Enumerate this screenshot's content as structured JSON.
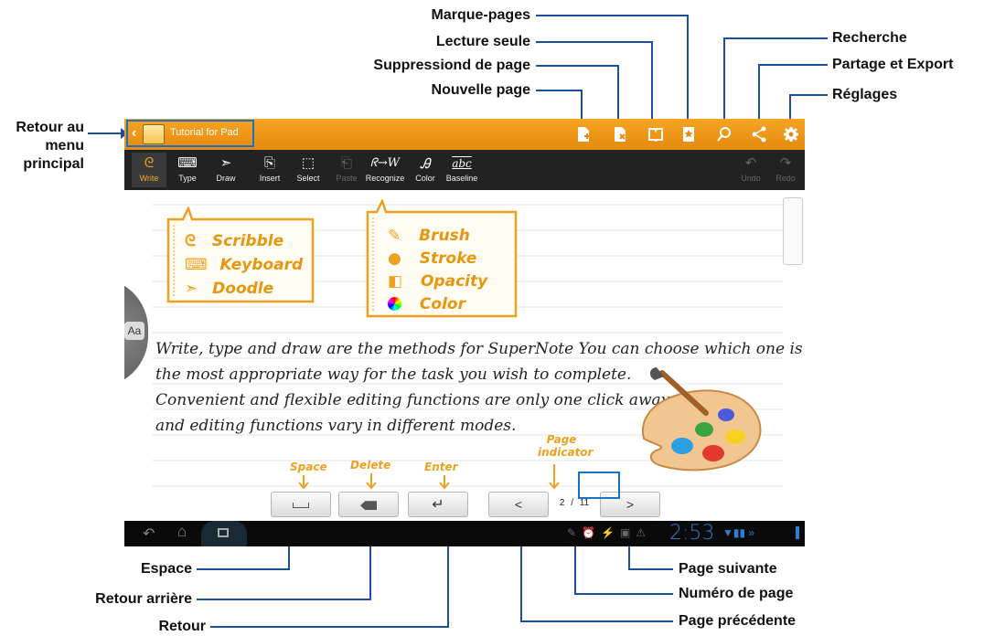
{
  "callouts": {
    "back_to_menu": "Retour au menu principal",
    "marque_pages": "Marque-pages",
    "lecture_seule": "Lecture seule",
    "suppression": "Suppressiond de page",
    "nouvelle_page": "Nouvelle page",
    "recherche": "Recherche",
    "partage": "Partage et Export",
    "reglages": "Réglages",
    "espace": "Espace",
    "retour_arriere": "Retour arrière",
    "retour": "Retour",
    "page_suivante": "Page suivante",
    "numero_page": "Numéro de page",
    "page_precedente": "Page précédente"
  },
  "app": {
    "notebook_title": "Tutorial for Pad",
    "toolbar": {
      "write": "Write",
      "type": "Type",
      "draw": "Draw",
      "insert": "Insert",
      "select": "Select",
      "paste": "Paste",
      "recognize": "Recognize",
      "color": "Color",
      "baseline": "Baseline",
      "undo": "Undo",
      "redo": "Redo",
      "baseline_icon_text": "abc",
      "recognize_icon_text": "ᖇ→W"
    },
    "bubble_left": [
      "Scribble",
      "Keyboard",
      "Doodle"
    ],
    "bubble_right": [
      "Brush",
      "Stroke",
      "Opacity",
      "Color"
    ],
    "handwriting": [
      "Write, type and draw are the methods for SuperNote You can choose which one is",
      "the most appropriate way for the task you wish to complete.",
      "Convenient and flexible editing functions are only one click away",
      "and editing functions vary in different modes."
    ],
    "key_labels": {
      "space": "Space",
      "delete": "Delete",
      "enter": "Enter",
      "page_indicator": "Page indicator"
    },
    "page": {
      "current": "2",
      "separator": "/",
      "total": "11"
    },
    "prev_glyph": "<",
    "next_glyph": ">",
    "side_tab": "Aa",
    "status": {
      "time": "2:53"
    }
  },
  "colors": {
    "accent": "#f5a623",
    "toolbar": "#222222",
    "ink": "#e6960f",
    "callout_line": "#1a4fa0"
  }
}
